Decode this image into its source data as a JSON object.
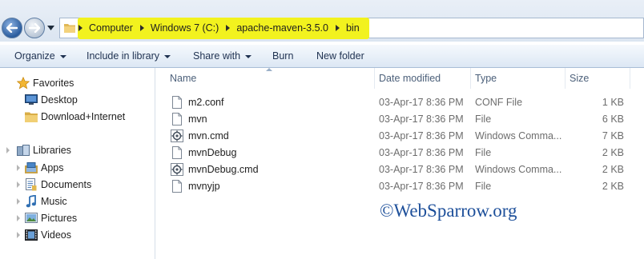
{
  "address_bar": {
    "crumbs": [
      "Computer",
      "Windows 7 (C:)",
      "apache-maven-3.5.0",
      "bin"
    ],
    "highlight_color": "#f2f21e"
  },
  "toolbar": {
    "organize": "Organize",
    "include_in_library": "Include in library",
    "share_with": "Share with",
    "burn": "Burn",
    "new_folder": "New folder"
  },
  "nav": {
    "favorites": {
      "label": "Favorites",
      "items": [
        {
          "label": "Desktop",
          "icon": "desktop-icon"
        },
        {
          "label": "Download+Internet",
          "icon": "folder-icon"
        }
      ]
    },
    "libraries": {
      "label": "Libraries",
      "items": [
        {
          "label": "Apps",
          "icon": "apps-library-icon"
        },
        {
          "label": "Documents",
          "icon": "documents-library-icon"
        },
        {
          "label": "Music",
          "icon": "music-library-icon"
        },
        {
          "label": "Pictures",
          "icon": "pictures-library-icon"
        },
        {
          "label": "Videos",
          "icon": "videos-library-icon"
        }
      ]
    }
  },
  "file_list": {
    "columns": [
      "Name",
      "Date modified",
      "Type",
      "Size"
    ],
    "rows": [
      {
        "name": "m2.conf",
        "date": "03-Apr-17 8:36 PM",
        "type": "CONF File",
        "size": "1 KB",
        "icon": "file-icon"
      },
      {
        "name": "mvn",
        "date": "03-Apr-17 8:36 PM",
        "type": "File",
        "size": "6 KB",
        "icon": "file-icon"
      },
      {
        "name": "mvn.cmd",
        "date": "03-Apr-17 8:36 PM",
        "type": "Windows Comma...",
        "size": "7 KB",
        "icon": "cmd-script-icon"
      },
      {
        "name": "mvnDebug",
        "date": "03-Apr-17 8:36 PM",
        "type": "File",
        "size": "2 KB",
        "icon": "file-icon"
      },
      {
        "name": "mvnDebug.cmd",
        "date": "03-Apr-17 8:36 PM",
        "type": "Windows Comma...",
        "size": "2 KB",
        "icon": "cmd-script-icon"
      },
      {
        "name": "mvnyjp",
        "date": "03-Apr-17 8:36 PM",
        "type": "File",
        "size": "2 KB",
        "icon": "file-icon"
      }
    ]
  },
  "watermark": "©WebSparrow.org"
}
